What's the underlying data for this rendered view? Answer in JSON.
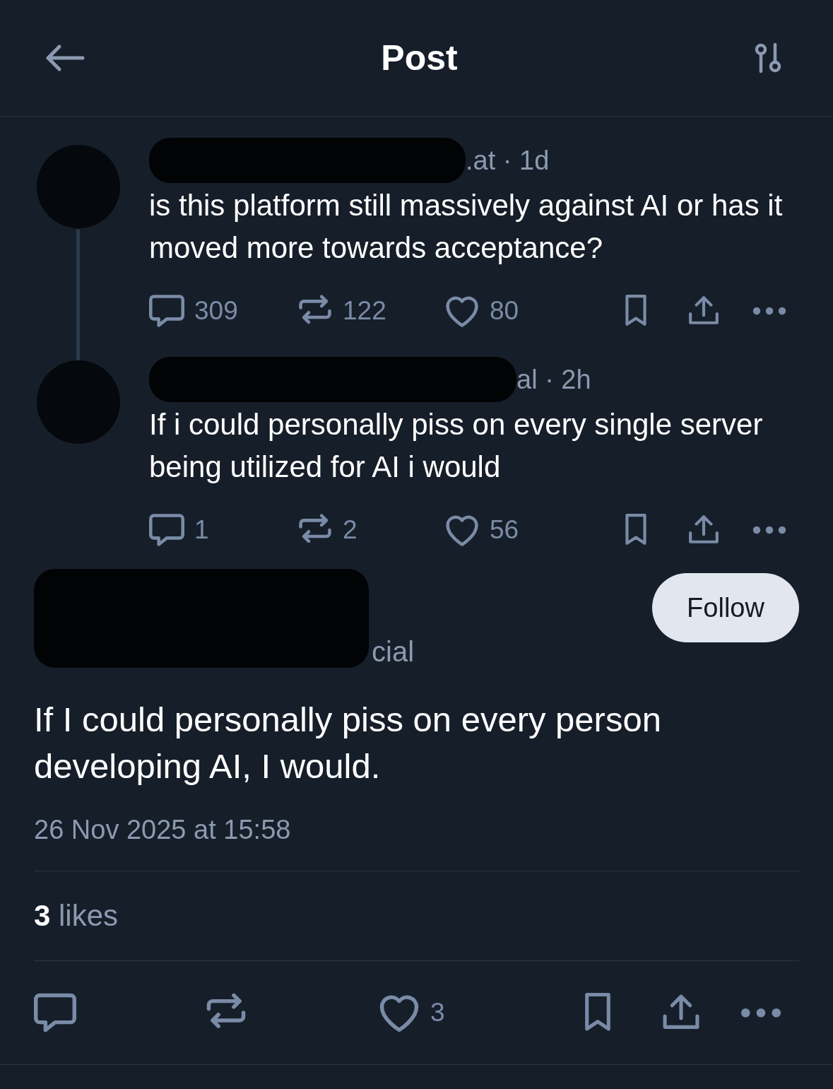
{
  "header": {
    "title": "Post"
  },
  "thread": [
    {
      "meta": ".at · 1d",
      "text": "is this platform still massively against AI or has it moved more towards acceptance?",
      "replies": "309",
      "reposts": "122",
      "likes": "80"
    },
    {
      "meta": "al · 2h",
      "text": "If i could personally piss on every single server being utilized for AI i would",
      "replies": "1",
      "reposts": "2",
      "likes": "56"
    }
  ],
  "post": {
    "handle": "cial",
    "follow_label": "Follow",
    "text": "If I could personally piss on every person developing AI, I would.",
    "timestamp": "26 Nov 2025 at 15:58",
    "like_count": "3",
    "likes_word": "likes",
    "like_total": "3"
  }
}
